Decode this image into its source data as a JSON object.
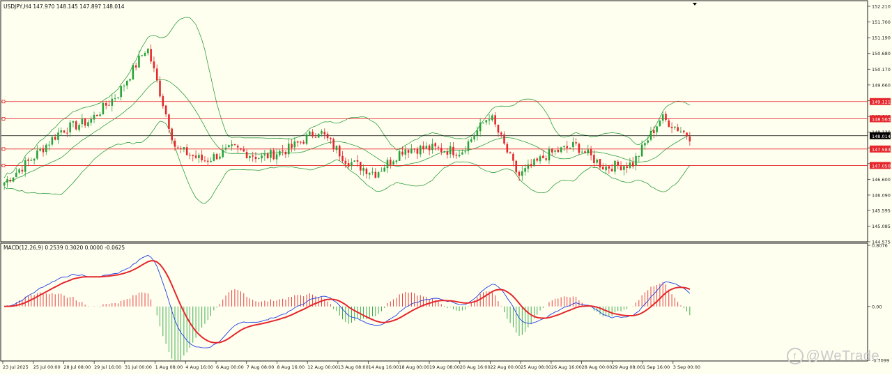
{
  "chart": {
    "header": "USDJPY,H4  147.970 148.145 147.897 148.014",
    "macd_header": "MACD(12,26,9) 0.2539 0.3020 0.0000 -0.0625",
    "watermark": "@WeTrade",
    "watermark_icon": "wetrade-logo-icon"
  },
  "chart_data": [
    {
      "type": "candlestick",
      "title": "USDJPY,H4",
      "ohlc_readout": [
        147.97,
        148.145,
        147.897,
        148.014
      ],
      "y_ticks": [
        "152.210",
        "151.700",
        "151.190",
        "150.680",
        "150.170",
        "149.660",
        "149.150",
        "148.640",
        "148.130",
        "147.620",
        "147.110",
        "146.600",
        "146.090",
        "145.595",
        "145.085",
        "144.575"
      ],
      "ylim": [
        144.575,
        152.21
      ],
      "x_ticks": [
        "23 Jul 2025",
        "25 Jul 00:00",
        "28 Jul 08:00",
        "29 Jul 16:00",
        "31 Jul 00:00",
        "1 Aug 08:00",
        "4 Aug 16:00",
        "6 Aug 00:00",
        "7 Aug 08:00",
        "8 Aug 16:00",
        "12 Aug 00:00",
        "13 Aug 08:00",
        "14 Aug 16:00",
        "18 Aug 00:00",
        "19 Aug 08:00",
        "20 Aug 16:00",
        "22 Aug 00:00",
        "25 Aug 08:00",
        "26 Aug 16:00",
        "28 Aug 00:00",
        "29 Aug 08:00",
        "1 Sep 16:00",
        "3 Sep 00:00"
      ],
      "horizontal_levels": [
        {
          "value": 149.121,
          "label": "149.121",
          "color": "#e5262b"
        },
        {
          "value": 148.563,
          "label": "148.563",
          "color": "#e5262b"
        },
        {
          "value": 147.583,
          "label": "147.583",
          "color": "#e5262b"
        },
        {
          "value": 147.05,
          "label": "147.050",
          "color": "#e5262b"
        }
      ],
      "current_price": {
        "value": 148.014,
        "label": "148.014",
        "color": "#000000"
      },
      "colors": {
        "bull": "#26a33a",
        "bear": "#e5262b",
        "band": "#2e9e3e",
        "level": "#e5262b",
        "current": "#000000"
      },
      "key_closes": [
        {
          "time": "23 Jul 2025",
          "close": 146.5
        },
        {
          "time": "25 Jul 00:00",
          "close": 147.3
        },
        {
          "time": "28 Jul 08:00",
          "close": 148.2
        },
        {
          "time": "29 Jul 16:00",
          "close": 148.5
        },
        {
          "time": "31 Jul 00:00",
          "close": 149.4
        },
        {
          "time": "31 Jul 16:00",
          "close": 150.9
        },
        {
          "time": "1 Aug 08:00",
          "close": 147.6
        },
        {
          "time": "4 Aug 16:00",
          "close": 147.2
        },
        {
          "time": "6 Aug 00:00",
          "close": 147.6
        },
        {
          "time": "7 Aug 08:00",
          "close": 147.3
        },
        {
          "time": "8 Aug 16:00",
          "close": 147.6
        },
        {
          "time": "12 Aug 00:00",
          "close": 148.2
        },
        {
          "time": "13 Aug 08:00",
          "close": 147.2
        },
        {
          "time": "14 Aug 16:00",
          "close": 146.8
        },
        {
          "time": "18 Aug 00:00",
          "close": 147.6
        },
        {
          "time": "19 Aug 08:00",
          "close": 147.6
        },
        {
          "time": "20 Aug 16:00",
          "close": 147.5
        },
        {
          "time": "22 Aug 00:00",
          "close": 148.7
        },
        {
          "time": "22 Aug 16:00",
          "close": 146.7
        },
        {
          "time": "25 Aug 08:00",
          "close": 147.4
        },
        {
          "time": "26 Aug 16:00",
          "close": 147.7
        },
        {
          "time": "28 Aug 00:00",
          "close": 147.0
        },
        {
          "time": "29 Aug 08:00",
          "close": 147.1
        },
        {
          "time": "1 Sep 16:00",
          "close": 148.6
        },
        {
          "time": "3 Sep 00:00",
          "close": 148.0
        }
      ]
    },
    {
      "type": "bar+line",
      "title": "MACD(12,26,9)",
      "readout": [
        "0.2539",
        "0.3020",
        "0.0000",
        "-0.0625"
      ],
      "y_ticks": [
        "0.8076",
        "0.00",
        "-0.7099"
      ],
      "ylim": [
        -0.7099,
        0.8076
      ],
      "colors": {
        "histogram_pos": "#e5262b",
        "histogram_neg": "#26a33a",
        "macd": "#1f3fe0",
        "signal": "#e5262b"
      }
    }
  ]
}
